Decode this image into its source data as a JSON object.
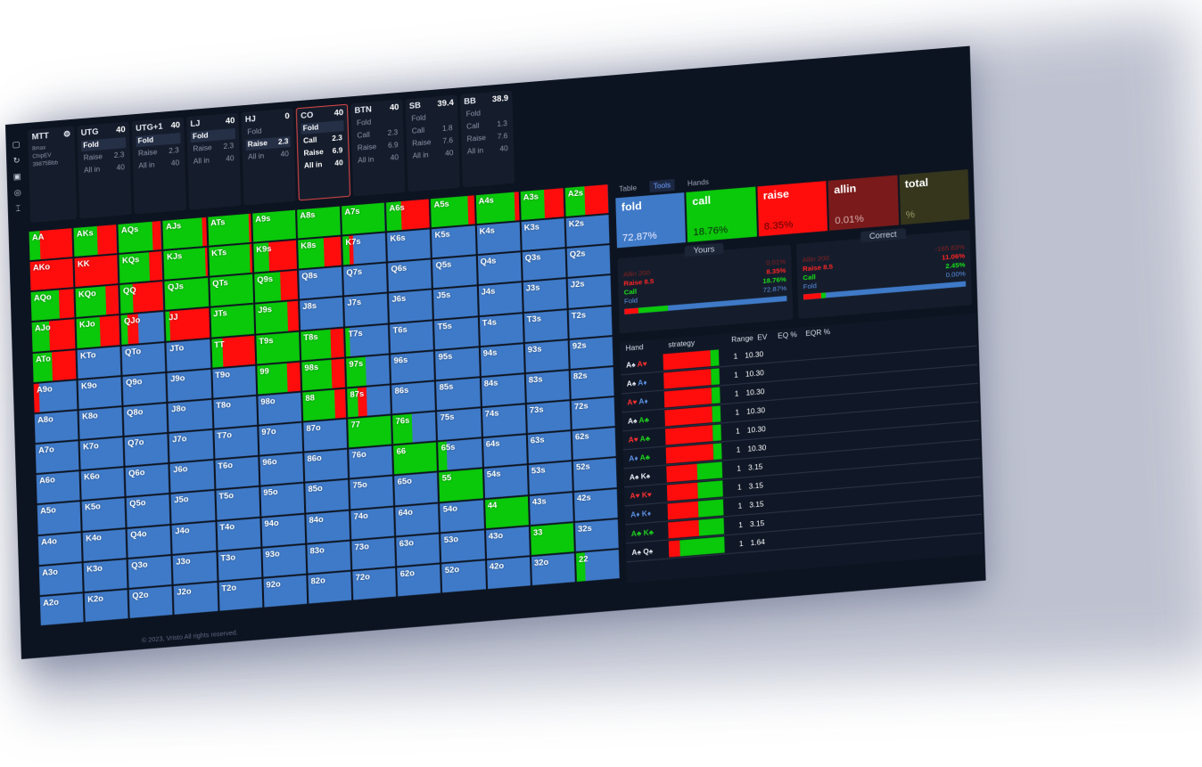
{
  "colors": {
    "fold": "#3f7ac8",
    "call": "#0ac80a",
    "raise": "#ff0d0d",
    "allin": "#7a1a1a",
    "bg": "#0d1421"
  },
  "rail_icons": [
    "copy-icon",
    "refresh-icon",
    "save-icon",
    "settings-icon",
    "sliders-icon"
  ],
  "game": {
    "title": "MTT",
    "lines": [
      "8max",
      "ChipEV",
      "39875Bbb"
    ]
  },
  "seats": [
    {
      "pos": "UTG",
      "stack": "40",
      "rows": [
        [
          "Fold",
          ""
        ],
        [
          "Raise",
          "2.3"
        ],
        [
          "All in",
          "40"
        ]
      ],
      "sel": 0
    },
    {
      "pos": "UTG+1",
      "stack": "40",
      "rows": [
        [
          "Fold",
          ""
        ],
        [
          "Raise",
          "2.3"
        ],
        [
          "All in",
          "40"
        ]
      ],
      "sel": 0
    },
    {
      "pos": "LJ",
      "stack": "40",
      "rows": [
        [
          "Fold",
          ""
        ],
        [
          "Raise",
          "2.3"
        ],
        [
          "All in",
          "40"
        ]
      ],
      "sel": 0
    },
    {
      "pos": "HJ",
      "stack": "0",
      "rows": [
        [
          "Fold",
          ""
        ],
        [
          "Raise",
          "2.3"
        ],
        [
          "All in",
          "40"
        ]
      ],
      "sel": 1
    },
    {
      "pos": "CO",
      "stack": "40",
      "rows": [
        [
          "Fold",
          ""
        ],
        [
          "Call",
          "2.3"
        ],
        [
          "Raise",
          "6.9"
        ],
        [
          "All in",
          "40"
        ]
      ],
      "sel": 0,
      "active": true
    },
    {
      "pos": "BTN",
      "stack": "40",
      "rows": [
        [
          "Fold",
          ""
        ],
        [
          "Call",
          "2.3"
        ],
        [
          "Raise",
          "6.9"
        ],
        [
          "All in",
          "40"
        ]
      ],
      "sel": -1
    },
    {
      "pos": "SB",
      "stack": "39.4",
      "rows": [
        [
          "Fold",
          ""
        ],
        [
          "Call",
          "1.8"
        ],
        [
          "Raise",
          "7.6"
        ],
        [
          "All in",
          "40"
        ]
      ],
      "sel": -1
    },
    {
      "pos": "BB",
      "stack": "38.9",
      "rows": [
        [
          "Fold",
          ""
        ],
        [
          "Call",
          "1.3"
        ],
        [
          "Raise",
          "7.6"
        ],
        [
          "All in",
          "40"
        ]
      ],
      "sel": -1
    }
  ],
  "grid": [
    [
      "AA",
      "AKs",
      "AQs",
      "AJs",
      "ATs",
      "A9s",
      "A8s",
      "A7s",
      "A6s",
      "A5s",
      "A4s",
      "A3s",
      "A2s"
    ],
    [
      "AKo",
      "KK",
      "KQs",
      "KJs",
      "KTs",
      "K9s",
      "K8s",
      "K7s",
      "K6s",
      "K5s",
      "K4s",
      "K3s",
      "K2s"
    ],
    [
      "AQo",
      "KQo",
      "QQ",
      "QJs",
      "QTs",
      "Q9s",
      "Q8s",
      "Q7s",
      "Q6s",
      "Q5s",
      "Q4s",
      "Q3s",
      "Q2s"
    ],
    [
      "AJo",
      "KJo",
      "QJo",
      "JJ",
      "JTs",
      "J9s",
      "J8s",
      "J7s",
      "J6s",
      "J5s",
      "J4s",
      "J3s",
      "J2s"
    ],
    [
      "ATo",
      "KTo",
      "QTo",
      "JTo",
      "TT",
      "T9s",
      "T8s",
      "T7s",
      "T6s",
      "T5s",
      "T4s",
      "T3s",
      "T2s"
    ],
    [
      "A9o",
      "K9o",
      "Q9o",
      "J9o",
      "T9o",
      "99",
      "98s",
      "97s",
      "96s",
      "95s",
      "94s",
      "93s",
      "92s"
    ],
    [
      "A8o",
      "K8o",
      "Q8o",
      "J8o",
      "T8o",
      "98o",
      "88",
      "87s",
      "86s",
      "85s",
      "84s",
      "83s",
      "82s"
    ],
    [
      "A7o",
      "K7o",
      "Q7o",
      "J7o",
      "T7o",
      "97o",
      "87o",
      "77",
      "76s",
      "75s",
      "74s",
      "73s",
      "72s"
    ],
    [
      "A6o",
      "K6o",
      "Q6o",
      "J6o",
      "T6o",
      "96o",
      "86o",
      "76o",
      "66",
      "65s",
      "64s",
      "63s",
      "62s"
    ],
    [
      "A5o",
      "K5o",
      "Q5o",
      "J5o",
      "T5o",
      "95o",
      "85o",
      "75o",
      "65o",
      "55",
      "54s",
      "53s",
      "52s"
    ],
    [
      "A4o",
      "K4o",
      "Q4o",
      "J4o",
      "T4o",
      "94o",
      "84o",
      "74o",
      "64o",
      "54o",
      "44",
      "43s",
      "42s"
    ],
    [
      "A3o",
      "K3o",
      "Q3o",
      "J3o",
      "T3o",
      "93o",
      "83o",
      "73o",
      "63o",
      "53o",
      "43o",
      "33",
      "32s"
    ],
    [
      "A2o",
      "K2o",
      "Q2o",
      "J2o",
      "T2o",
      "92o",
      "82o",
      "72o",
      "62o",
      "52o",
      "42o",
      "32o",
      "22"
    ]
  ],
  "mix": {
    "AA": [
      0,
      0.25,
      0.75
    ],
    "AKs": [
      0,
      0.55,
      0.45
    ],
    "AQs": [
      0,
      0.8,
      0.2
    ],
    "AJs": [
      0,
      0.9,
      0.1
    ],
    "ATs": [
      0,
      0.95,
      0.05
    ],
    "A9s": [
      0,
      1,
      0
    ],
    "A8s": [
      0,
      1,
      0
    ],
    "A7s": [
      0,
      1,
      0
    ],
    "A6s": [
      0,
      0.35,
      0.65
    ],
    "A5s": [
      0,
      0.85,
      0.15
    ],
    "A4s": [
      0,
      0.9,
      0.1
    ],
    "A3s": [
      0,
      0.55,
      0.45
    ],
    "A2s": [
      0,
      0.45,
      0.55
    ],
    "AKo": [
      0,
      0,
      1
    ],
    "KK": [
      0,
      0,
      1
    ],
    "KQs": [
      0,
      0.7,
      0.3
    ],
    "KJs": [
      0,
      0.95,
      0.05
    ],
    "KTs": [
      0,
      0.95,
      0.05
    ],
    "K9s": [
      0,
      0.35,
      0.65
    ],
    "K8s": [
      0,
      0.6,
      0.4
    ],
    "K7s": [
      0.75,
      0.15,
      0.1
    ],
    "AQo": [
      0,
      0.65,
      0.35
    ],
    "KQo": [
      0,
      0.7,
      0.3
    ],
    "QQ": [
      0,
      0.3,
      0.7
    ],
    "QJs": [
      0,
      1,
      0
    ],
    "QTs": [
      0,
      1,
      0
    ],
    "Q9s": [
      0,
      0.6,
      0.4
    ],
    "AJo": [
      0,
      0.4,
      0.6
    ],
    "KJo": [
      0,
      0.55,
      0.45
    ],
    "QJo": [
      0.6,
      0.15,
      0.25
    ],
    "JJ": [
      0,
      0.1,
      0.9
    ],
    "JTs": [
      0,
      1,
      0
    ],
    "J9s": [
      0,
      0.75,
      0.25
    ],
    "ATo": [
      0,
      0.45,
      0.55
    ],
    "TT": [
      0,
      0.25,
      0.75
    ],
    "T9s": [
      0,
      1,
      0
    ],
    "T8s": [
      0,
      0.7,
      0.3
    ],
    "T7s": [
      0.9,
      0.1,
      0
    ],
    "99": [
      0,
      0.7,
      0.3
    ],
    "98s": [
      0,
      0.7,
      0.3
    ],
    "97s": [
      0.55,
      0.45,
      0
    ],
    "A9o": [
      0.88,
      0,
      0.12
    ],
    "88": [
      0,
      0.75,
      0.25
    ],
    "87s": [
      0.55,
      0.25,
      0.2
    ],
    "77": [
      0,
      1,
      0
    ],
    "76s": [
      0.55,
      0.45,
      0
    ],
    "66": [
      0,
      1,
      0
    ],
    "65s": [
      0.8,
      0.2,
      0
    ],
    "55": [
      0,
      1,
      0
    ],
    "44": [
      0,
      1,
      0
    ],
    "33": [
      0,
      1,
      0
    ],
    "22": [
      0.8,
      0.2,
      0
    ]
  },
  "tabs": [
    "Table",
    "Tools",
    "Hands"
  ],
  "active_tab": 1,
  "actions": [
    {
      "label": "fold",
      "pct": "72.87%",
      "cls": "fold"
    },
    {
      "label": "call",
      "pct": "18.76%",
      "cls": "call"
    },
    {
      "label": "raise",
      "pct": "8.35%",
      "cls": "raise"
    },
    {
      "label": "allin",
      "pct": "0.01%",
      "cls": "allin"
    },
    {
      "label": "total",
      "pct": "%",
      "cls": "total"
    }
  ],
  "yours": {
    "title": "Yours",
    "lines": [
      [
        "Allin 200",
        "0.01%",
        "c-allin"
      ],
      [
        "Raise 8.5",
        "8.35%",
        "c-raise"
      ],
      [
        "Call",
        "18.76%",
        "c-call"
      ],
      [
        "Fold",
        "72.87%",
        "c-fold"
      ]
    ],
    "bar": [
      0.0001,
      0.0835,
      0.1876,
      0.7287
    ]
  },
  "correct": {
    "title": "Correct",
    "lines": [
      [
        "Allin 200",
        "-165.83%",
        "c-allin"
      ],
      [
        "Raise 8.5",
        "11.06%",
        "c-raise"
      ],
      [
        "Call",
        "2.45%",
        "c-call"
      ],
      [
        "Fold",
        "0.00%",
        "c-fold"
      ]
    ],
    "bar": [
      0,
      0.1106,
      0.0245,
      0
    ]
  },
  "table_headers": [
    "Hand",
    "strategy",
    "Range",
    "EV",
    "EQ %",
    "EQR %"
  ],
  "table_rows": [
    {
      "c1": "A♠",
      "c1col": "white",
      "c2": "A♥",
      "c2col": "red",
      "strat": [
        0.85,
        0.15
      ],
      "range": "1",
      "ev": "10.30"
    },
    {
      "c1": "A♠",
      "c1col": "white",
      "c2": "A♦",
      "c2col": "blue",
      "strat": [
        0.85,
        0.15
      ],
      "range": "1",
      "ev": "10.30"
    },
    {
      "c1": "A♥",
      "c1col": "red",
      "c2": "A♦",
      "c2col": "blue",
      "strat": [
        0.85,
        0.15
      ],
      "range": "1",
      "ev": "10.30"
    },
    {
      "c1": "A♠",
      "c1col": "white",
      "c2": "A♣",
      "c2col": "green",
      "strat": [
        0.85,
        0.15
      ],
      "range": "1",
      "ev": "10.30"
    },
    {
      "c1": "A♥",
      "c1col": "red",
      "c2": "A♣",
      "c2col": "green",
      "strat": [
        0.85,
        0.15
      ],
      "range": "1",
      "ev": "10.30"
    },
    {
      "c1": "A♦",
      "c1col": "blue",
      "c2": "A♣",
      "c2col": "green",
      "strat": [
        0.85,
        0.15
      ],
      "range": "1",
      "ev": "10.30"
    },
    {
      "c1": "A♠",
      "c1col": "white",
      "c2": "K♠",
      "c2col": "white",
      "strat": [
        0.55,
        0.45
      ],
      "range": "1",
      "ev": "3.15"
    },
    {
      "c1": "A♥",
      "c1col": "red",
      "c2": "K♥",
      "c2col": "red",
      "strat": [
        0.55,
        0.45
      ],
      "range": "1",
      "ev": "3.15"
    },
    {
      "c1": "A♦",
      "c1col": "blue",
      "c2": "K♦",
      "c2col": "blue",
      "strat": [
        0.55,
        0.45
      ],
      "range": "1",
      "ev": "3.15"
    },
    {
      "c1": "A♣",
      "c1col": "green",
      "c2": "K♣",
      "c2col": "green",
      "strat": [
        0.55,
        0.45
      ],
      "range": "1",
      "ev": "3.15"
    },
    {
      "c1": "A♠",
      "c1col": "white",
      "c2": "Q♠",
      "c2col": "white",
      "strat": [
        0.2,
        0.8
      ],
      "range": "1",
      "ev": "1.64"
    }
  ],
  "footer": "© 2023, Vristo All rights reserved."
}
